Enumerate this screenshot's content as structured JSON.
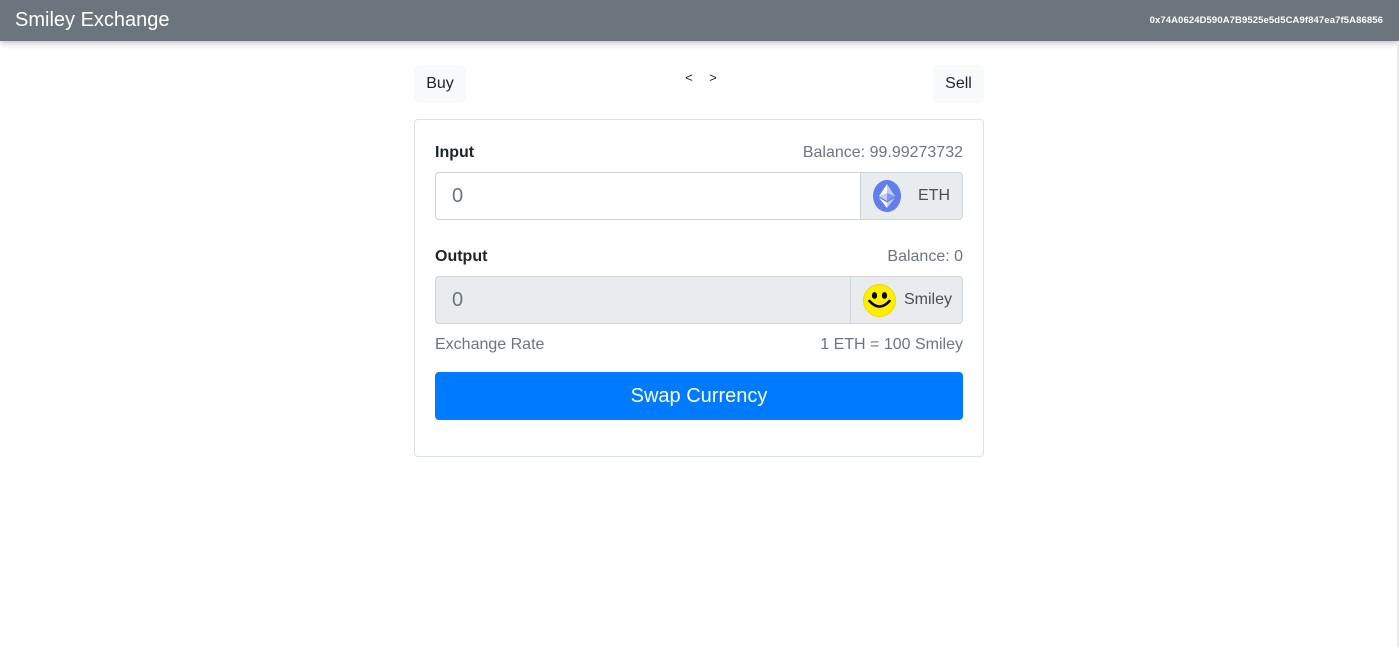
{
  "navbar": {
    "brand": "Smiley Exchange",
    "account": "0x74A0624D590A7B9525e5d5CA9f847ea7f5A86856"
  },
  "mode_toggle": {
    "buy_label": "Buy",
    "sell_label": "Sell",
    "prev_label": "<",
    "next_label": ">"
  },
  "input": {
    "label": "Input",
    "balance": "Balance: 99.99273732",
    "value": "0",
    "currency": "ETH",
    "icon": "ethereum-icon"
  },
  "output": {
    "label": "Output",
    "balance": "Balance: 0",
    "value": "0",
    "currency": "Smiley",
    "icon": "smiley-icon"
  },
  "exchange_rate": {
    "label": "Exchange Rate",
    "value": "1 ETH = 100 Smiley"
  },
  "swap_button": {
    "label": "Swap Currency"
  },
  "colors": {
    "navbar": "#6c757d",
    "primary": "#007bff",
    "ethereum": "#627eea",
    "smiley": "#ffee00"
  }
}
